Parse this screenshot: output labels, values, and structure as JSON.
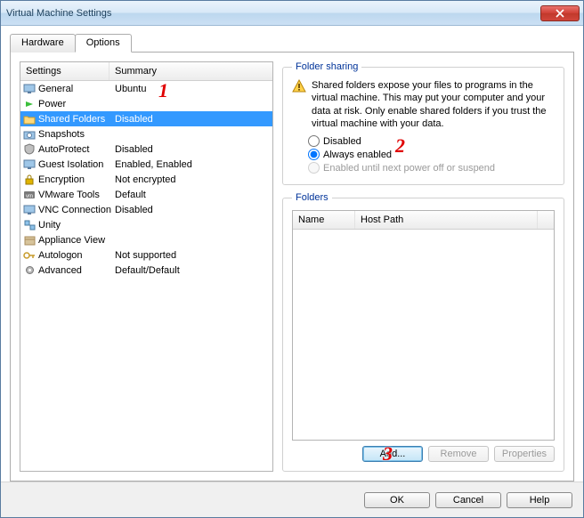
{
  "window": {
    "title": "Virtual Machine Settings"
  },
  "tabs": {
    "hardware": "Hardware",
    "options": "Options"
  },
  "list": {
    "headers": {
      "settings": "Settings",
      "summary": "Summary"
    },
    "items": [
      {
        "name": "General",
        "summary": "Ubuntu",
        "icon": "monitor-icon",
        "sel": false
      },
      {
        "name": "Power",
        "summary": "",
        "icon": "power-icon",
        "sel": false
      },
      {
        "name": "Shared Folders",
        "summary": "Disabled",
        "icon": "folder-icon",
        "sel": true
      },
      {
        "name": "Snapshots",
        "summary": "",
        "icon": "camera-icon",
        "sel": false
      },
      {
        "name": "AutoProtect",
        "summary": "Disabled",
        "icon": "shield-icon",
        "sel": false
      },
      {
        "name": "Guest Isolation",
        "summary": "Enabled, Enabled",
        "icon": "monitor-icon",
        "sel": false
      },
      {
        "name": "Encryption",
        "summary": "Not encrypted",
        "icon": "lock-icon",
        "sel": false
      },
      {
        "name": "VMware Tools",
        "summary": "Default",
        "icon": "vmw-icon",
        "sel": false
      },
      {
        "name": "VNC Connections",
        "summary": "Disabled",
        "icon": "monitor-icon",
        "sel": false
      },
      {
        "name": "Unity",
        "summary": "",
        "icon": "unity-icon",
        "sel": false
      },
      {
        "name": "Appliance View",
        "summary": "",
        "icon": "box-icon",
        "sel": false
      },
      {
        "name": "Autologon",
        "summary": "Not supported",
        "icon": "key-icon",
        "sel": false
      },
      {
        "name": "Advanced",
        "summary": "Default/Default",
        "icon": "gear-icon",
        "sel": false
      }
    ]
  },
  "sharing": {
    "legend": "Folder sharing",
    "warning": "Shared folders expose your files to programs in the virtual machine. This may put your computer and your data at risk. Only enable shared folders if you trust the virtual machine with your data.",
    "radios": {
      "disabled": "Disabled",
      "always": "Always enabled",
      "until": "Enabled until next power off or suspend"
    },
    "selected": "always"
  },
  "folders": {
    "legend": "Folders",
    "headers": {
      "name": "Name",
      "hostpath": "Host Path"
    },
    "buttons": {
      "add": "Add...",
      "remove": "Remove",
      "props": "Properties"
    }
  },
  "bottom": {
    "ok": "OK",
    "cancel": "Cancel",
    "help": "Help"
  },
  "annotations": {
    "a1": "1",
    "a2": "2",
    "a3": "3"
  }
}
